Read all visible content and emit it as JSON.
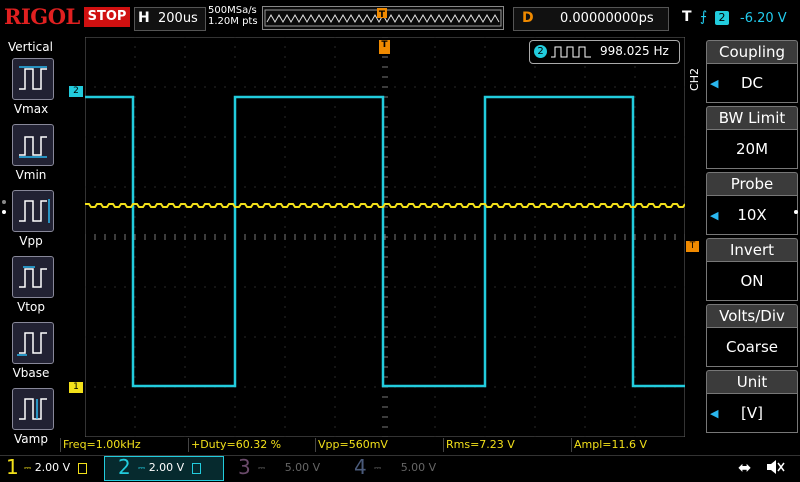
{
  "brand": "RIGOL",
  "status": "STOP",
  "timebase": {
    "label": "H",
    "value": "200us"
  },
  "sample": {
    "rate": "500MSa/s",
    "points": "1.20M pts"
  },
  "trigger_marker": "T",
  "delay": {
    "label": "D",
    "value": "0.00000000ps"
  },
  "trigger": {
    "label": "T",
    "source": "2",
    "level": "-6.20 V"
  },
  "left_menu": {
    "title": "Vertical",
    "items": [
      "Vmax",
      "Vmin",
      "Vpp",
      "Vtop",
      "Vbase",
      "Vamp"
    ]
  },
  "freq_counter": {
    "channel": "2",
    "value": "998.025 Hz"
  },
  "right_menu": {
    "channel_tag": "CH2",
    "items": [
      {
        "title": "Coupling",
        "value": "DC"
      },
      {
        "title": "BW Limit",
        "value": "20M"
      },
      {
        "title": "Probe",
        "value": "10X"
      },
      {
        "title": "Invert",
        "value": "ON"
      },
      {
        "title": "Volts/Div",
        "value": "Coarse"
      },
      {
        "title": "Unit",
        "value": "[V]"
      }
    ]
  },
  "channel_markers": {
    "ch1": "1",
    "ch2": "2",
    "trig_level": "T"
  },
  "measurements": [
    {
      "label": "Freq=1.00kHz"
    },
    {
      "label": "+Duty=60.32 %"
    },
    {
      "label": "Vpp=560mV"
    },
    {
      "label": "Rms=7.23 V"
    },
    {
      "label": "Ampl=11.6 V"
    }
  ],
  "channels": [
    {
      "num": "1",
      "scale": "2.00 V",
      "color": "#f2e01a",
      "active": true
    },
    {
      "num": "2",
      "scale": "2.00 V",
      "color": "#22ccdd",
      "active": true
    },
    {
      "num": "3",
      "scale": "5.00 V",
      "color": "#b070b0",
      "active": false
    },
    {
      "num": "4",
      "scale": "5.00 V",
      "color": "#6080c0",
      "active": false
    }
  ],
  "colors": {
    "ch1": "#f2e01a",
    "ch2": "#22ccdd",
    "trigger": "#f08a00",
    "brand": "#e02020"
  }
}
